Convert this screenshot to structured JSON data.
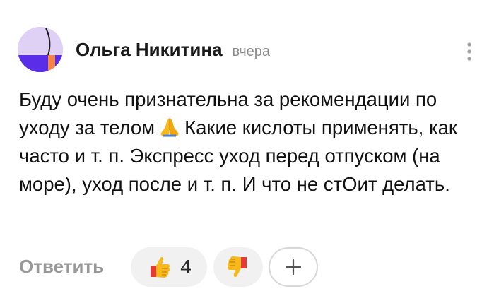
{
  "comment": {
    "author": "Ольга Никитина",
    "time": "вчера",
    "text_before_emoji": "Буду очень признательна за рекомендации по уходу за телом",
    "text_after_emoji": "Какие кислоты применять, как часто и т. п. Экспресс уход перед отпуском (на море), уход после и т. п. И что не стОит делать."
  },
  "actions": {
    "reply_label": "Ответить",
    "like_count": "4"
  },
  "icons": {
    "avatar": "avatar-abstract",
    "menu": "more-vertical-icon",
    "emoji": "folded-hands-emoji",
    "like": "thumbs-up-icon",
    "dislike": "thumbs-down-icon",
    "add_reaction": "plus-icon"
  },
  "colors": {
    "avatar_background": "#dfd0f6",
    "avatar_primary": "#5a2ee8",
    "avatar_accent": "#f2844a",
    "reaction_yellow": "#f6b81c",
    "reaction_red": "#e53935",
    "muted_text": "#999999"
  }
}
